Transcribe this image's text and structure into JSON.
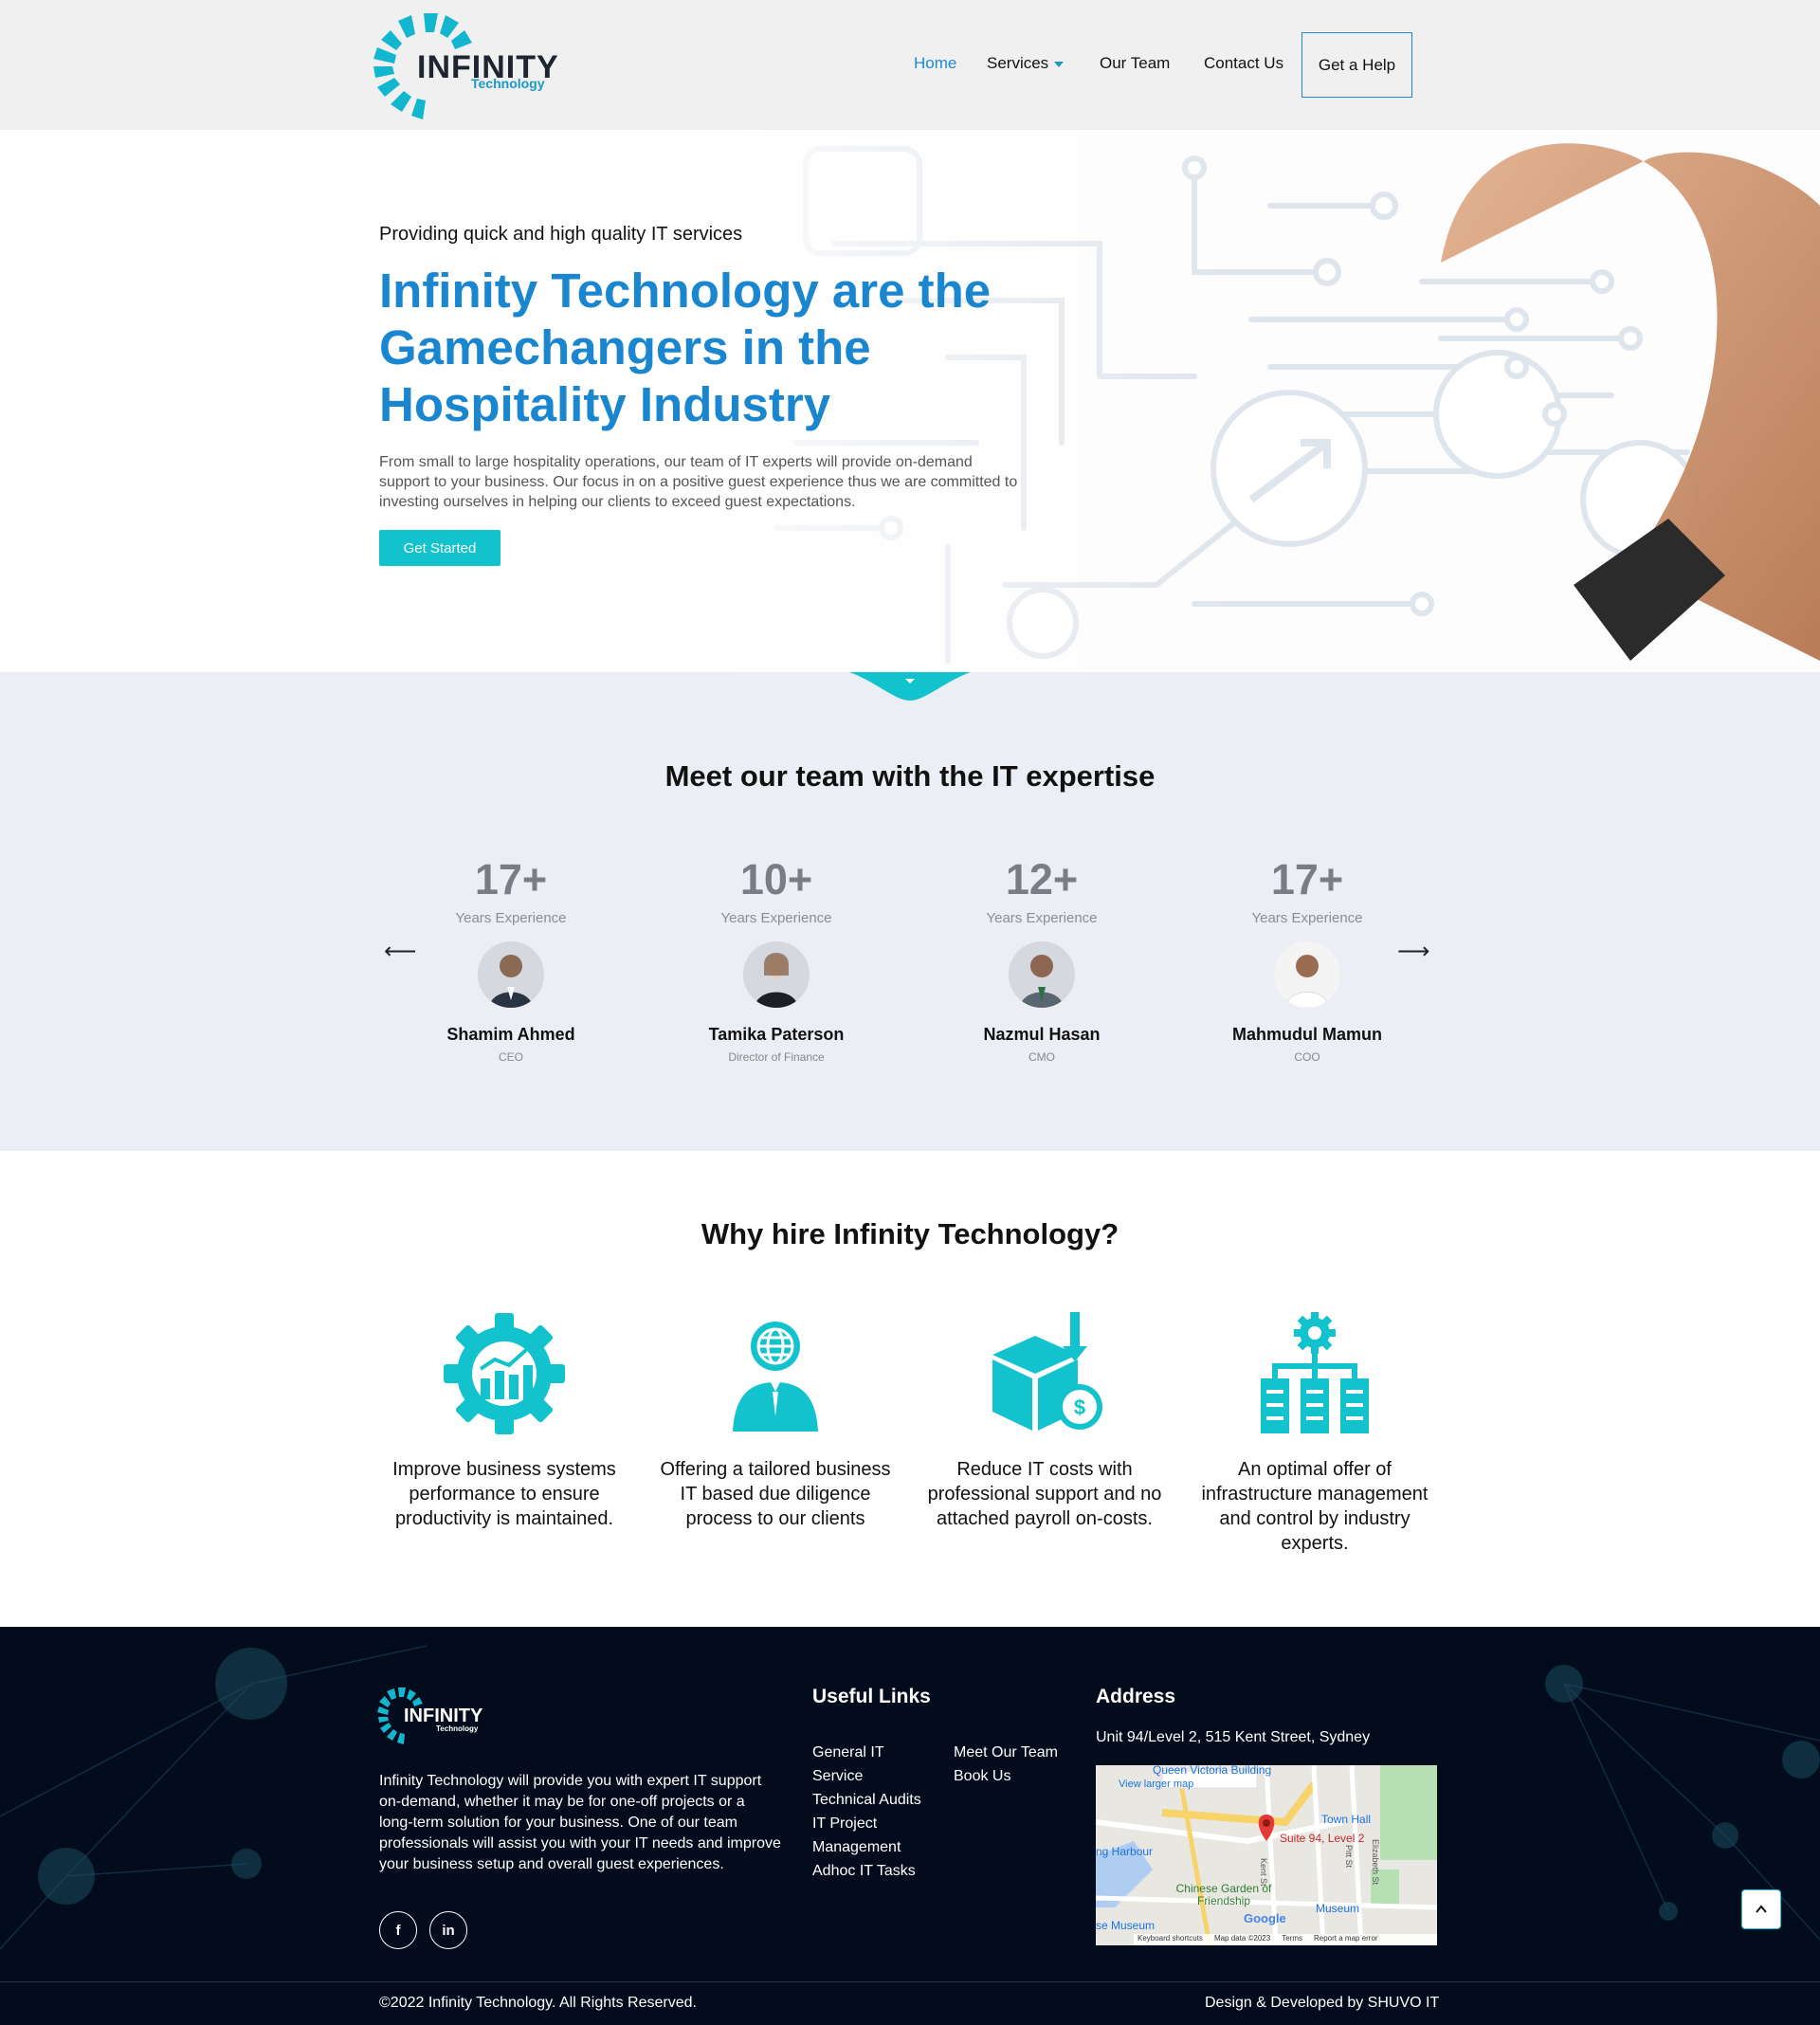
{
  "brand": {
    "name": "INFINITY",
    "sub": "Technology",
    "accent": "#12c3cd",
    "primary": "#1a86d0"
  },
  "nav": {
    "items": [
      {
        "label": "Home"
      },
      {
        "label": "Services"
      },
      {
        "label": "Our Team"
      },
      {
        "label": "Contact Us"
      }
    ],
    "cta": "Get a Help"
  },
  "hero": {
    "subtitle": "Providing quick and high quality IT services",
    "title": "Infinity Technology are the Gamechangers in the Hospitality Industry",
    "description": "From small to large hospitality operations, our team of IT experts will provide on-demand support to your business. Our focus in on a positive guest experience thus we are committed to investing ourselves in helping our clients to exceed guest expectations.",
    "button": "Get Started"
  },
  "team": {
    "title": "Meet our team with the IT expertise",
    "members": [
      {
        "years": "17+",
        "label": "Years Experience",
        "name": "Shamim Ahmed",
        "role": "CEO"
      },
      {
        "years": "10+",
        "label": "Years Experience",
        "name": "Tamika Paterson",
        "role": "Director of Finance"
      },
      {
        "years": "12+",
        "label": "Years Experience",
        "name": "Nazmul Hasan",
        "role": "CMO"
      },
      {
        "years": "17+",
        "label": "Years Experience",
        "name": "Mahmudul Mamun",
        "role": "COO"
      }
    ]
  },
  "why": {
    "title": "Why hire Infinity Technology?",
    "features": [
      {
        "icon": "gear-chart-icon",
        "text": "Improve business systems performance to ensure productivity is maintained."
      },
      {
        "icon": "globe-person-icon",
        "text": "Offering a tailored business IT based due diligence process to our clients"
      },
      {
        "icon": "box-dollar-icon",
        "text": "Reduce IT costs with professional support and no attached payroll on-costs."
      },
      {
        "icon": "gear-servers-icon",
        "text": "An optimal offer of infrastructure management and control by industry experts."
      }
    ]
  },
  "footer": {
    "about": "Infinity Technology will provide you with expert IT support on-demand, whether it may be for one-off projects or a long-term solution for your business. One of our team professionals will assist you with your IT needs and improve your business setup and overall guest experiences.",
    "useful_title": "Useful Links",
    "links_col1": [
      "General IT",
      "Service",
      "Technical Audits",
      "IT Project",
      "Management",
      "Adhoc IT Tasks"
    ],
    "links_col2": [
      "Meet Our Team",
      "Book Us"
    ],
    "address_title": "Address",
    "address": "Unit 94/Level 2, 515 Kent Street, Sydney",
    "map": {
      "larger": "View larger map",
      "pin": "Suite 94, Level 2",
      "labels": [
        "Queen Victoria Building",
        "Town Hall",
        "ng Harbour",
        "Chinese Garden of Friendship",
        "Museum",
        "se Museum",
        "Kent St",
        "Pitt St",
        "Elizabeth St"
      ],
      "footer": [
        "Keyboard shortcuts",
        "Map data ©2023",
        "Terms",
        "Report a map error"
      ],
      "google": "Google"
    },
    "social": [
      {
        "icon": "facebook-icon",
        "label": "f"
      },
      {
        "icon": "linkedin-icon",
        "label": "in"
      }
    ],
    "copyright": "©2022 Infinity Technology. All Rights Reserved.",
    "developer": "Design & Developed by SHUVO IT"
  }
}
